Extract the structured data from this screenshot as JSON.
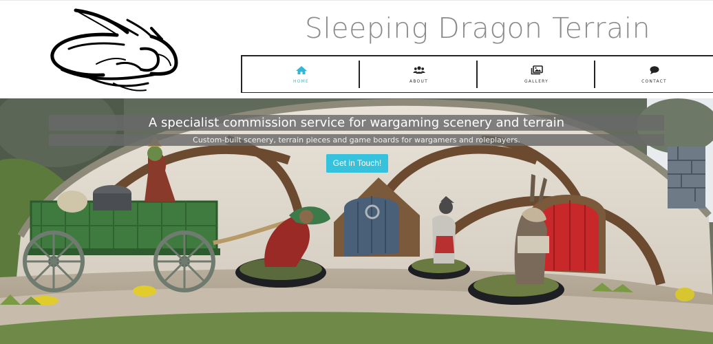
{
  "header": {
    "site_title": "Sleeping Dragon Terrain",
    "logo_icon": "sleeping-dragon-logo"
  },
  "nav": {
    "items": [
      {
        "label": "HOME",
        "icon": "home-icon",
        "active": true
      },
      {
        "label": "ABOUT",
        "icon": "users-icon",
        "active": false
      },
      {
        "label": "GALLERY",
        "icon": "images-icon",
        "active": false
      },
      {
        "label": "CONTACT",
        "icon": "chat-bubble-icon",
        "active": false
      }
    ],
    "active_color": "#34b7d6"
  },
  "hero": {
    "title": "A specialist commission service for wargaming scenery and terrain",
    "subtitle": "Custom-built scenery, terrain pieces and game boards for wargamers and roleplayers.",
    "cta_label": "Get in Touch!",
    "cta_color": "#36c2dd"
  }
}
